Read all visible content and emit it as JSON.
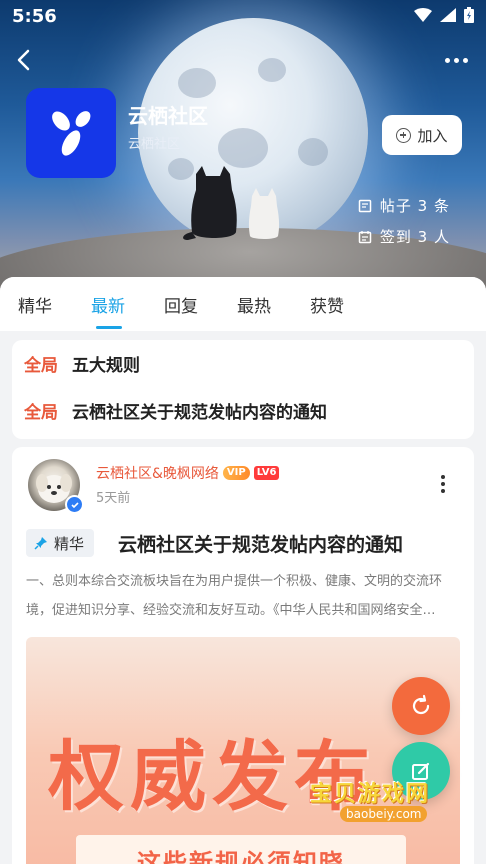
{
  "status_bar": {
    "time": "5:56"
  },
  "community": {
    "name": "云栖社区",
    "subtitle": "云栖社区",
    "join_label": "加入",
    "posts_stat": "帖子 3 条",
    "checkin_stat": "签到 3 人"
  },
  "tabs": [
    {
      "label": "精华",
      "active": false
    },
    {
      "label": "最新",
      "active": true
    },
    {
      "label": "回复",
      "active": false
    },
    {
      "label": "最热",
      "active": false
    },
    {
      "label": "获赞",
      "active": false
    }
  ],
  "notices": [
    {
      "tag": "全局",
      "text": "五大规则"
    },
    {
      "tag": "全局",
      "text": "云栖社区关于规范发帖内容的通知"
    }
  ],
  "post": {
    "author": "云栖社区&晚枫网络",
    "vip_badge": "VIP",
    "level_badge": "LV6",
    "time": "5天前",
    "essence_label": "精华",
    "title": "云栖社区关于规范发帖内容的通知",
    "excerpt": "一、总则本综合交流板块旨在为用户提供一个积极、健康、文明的交流环境，促进知识分享、经验交流和友好互动。《中华人民共和国网络安全…",
    "banner_main": "权威发布",
    "banner_sub": "这些新规必须知晓"
  },
  "watermark": {
    "title": "宝贝游戏网",
    "url": "baobeiy.com"
  },
  "colors": {
    "accent_blue": "#1aa3e6",
    "notice_red": "#e8593b",
    "logo_blue": "#1537e8",
    "fab_refresh": "#f36a3d",
    "fab_edit": "#2fcaa7"
  }
}
